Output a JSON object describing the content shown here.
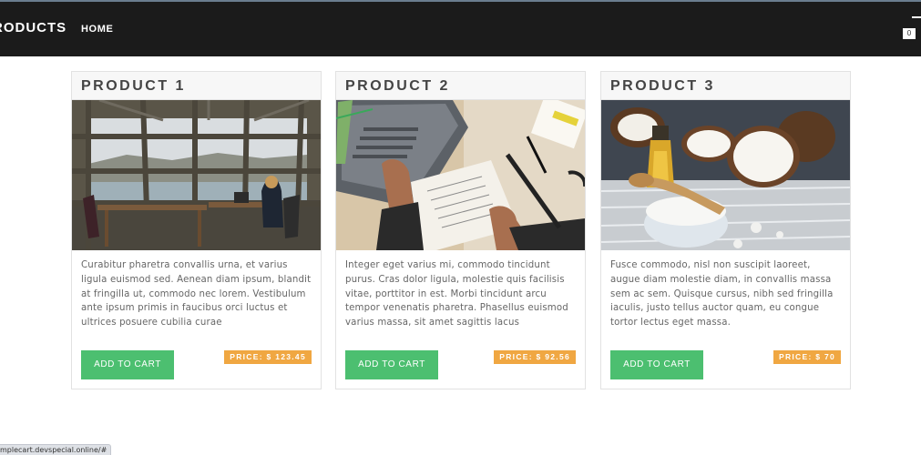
{
  "navbar": {
    "brand": "RODUCTS",
    "home_label": "HOME",
    "cart_count": "0"
  },
  "products": [
    {
      "title": "PRODUCT 1",
      "image": "office-window-photo",
      "description": "Curabitur pharetra convallis urna, et varius ligula euismod sed. Aenean diam ipsum, blandit at fringilla ut, commodo nec lorem. Vestibulum ante ipsum primis in faucibus orci luctus et ultrices posuere cubilia curae",
      "button_label": "ADD TO CART",
      "price": "PRICE: $ 123.45"
    },
    {
      "title": "PRODUCT 2",
      "image": "laptop-notebook-photo",
      "description": "Integer eget varius mi, commodo tincidunt purus. Cras dolor ligula, molestie quis facilisis vitae, porttitor in est. Morbi tincidunt arcu tempor venenatis pharetra. Phasellus euismod varius massa, sit amet sagittis lacus",
      "button_label": "ADD TO CART",
      "price": "PRICE: $ 92.56"
    },
    {
      "title": "PRODUCT 3",
      "image": "coconut-oil-photo",
      "description": "Fusce commodo, nisl non suscipit laoreet, augue diam molestie diam, in convallis massa sem ac sem. Quisque cursus, nibh sed fringilla iaculis, justo tellus auctor quam, eu congue tortor lectus eget massa.",
      "button_label": "ADD TO CART",
      "price": "PRICE: $ 70"
    }
  ],
  "status_bar": {
    "url": "mplecart.devspecial.online/#"
  },
  "colors": {
    "navbar_bg": "#1b1b1b",
    "button_green": "#4cbf70",
    "price_orange": "#f0a742"
  }
}
